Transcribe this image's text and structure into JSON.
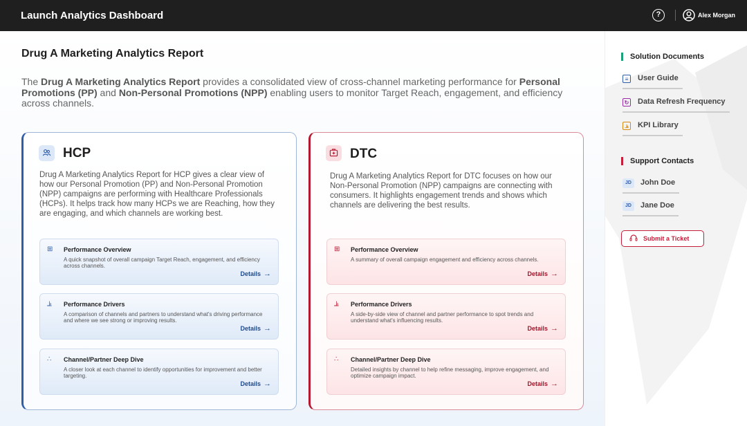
{
  "topbar": {
    "title": "Launch Analytics Dashboard",
    "help_glyph": "?",
    "user_name": "Alex Morgan"
  },
  "page": {
    "title": "Drug A Marketing Analytics Report",
    "intro": [
      {
        "text": "The ",
        "bold": false
      },
      {
        "text": "Drug A Marketing Analytics Report",
        "bold": true
      },
      {
        "text": " provides a consolidated view of cross-channel marketing performance for ",
        "bold": false
      },
      {
        "text": "Personal Promotions (PP)",
        "bold": true
      },
      {
        "text": " and ",
        "bold": false
      },
      {
        "text": "Non-Personal Promotions (NPP)",
        "bold": true
      },
      {
        "text": " enabling users to monitor Target Reach, engagement, and efficiency across channels.",
        "bold": false
      }
    ]
  },
  "hcp": {
    "title": "HCP",
    "icon": "people-icon",
    "desc": "Drug A Marketing Analytics Report for HCP gives a clear view of how our Personal Promotion (PP) and  Non-Personal Promotion (NPP) campaigns are performing with Healthcare Professionals (HCPs). It helps track how many HCPs we are Reaching, how they are engaging, and which channels are working best.",
    "items": [
      {
        "title": "Performance Overview",
        "desc": "A quick snapshot of overall campaign Target Reach, engagement, and efficiency across channels.",
        "details": "Details"
      },
      {
        "title": "Performance Drivers",
        "desc": "A comparison of channels and partners to understand what's driving performance and where we see strong or improving results.",
        "details": "Details"
      },
      {
        "title": "Channel/Partner Deep Dive",
        "desc": "A closer look at each channel to identify opportunities for improvement and better targeting.",
        "details": "Details"
      }
    ]
  },
  "dtc": {
    "title": "DTC",
    "icon": "medical-kit-icon",
    "desc": "Drug A Marketing Analytics Report for DTC focuses on how our Non-Personal Promotion (NPP) campaigns are connecting with consumers. It highlights engagement trends and shows which channels are delivering the best results.",
    "items": [
      {
        "title": "Performance Overview",
        "desc": "A summary of overall campaign engagement and efficiency across channels.",
        "details": "Details"
      },
      {
        "title": "Performance Drivers",
        "desc": "A side-by-side view of channel and partner performance to spot trends and understand what's influencing results.",
        "details": "Details"
      },
      {
        "title": "Channel/Partner Deep Dive",
        "desc": "Detailed insights by channel to help refine messaging, improve engagement, and optimize campaign impact.",
        "details": "Details"
      }
    ]
  },
  "sidebar": {
    "docs_heading": "Solution Documents",
    "docs": [
      {
        "label": "User Guide",
        "icon": "document-icon"
      },
      {
        "label": "Data Refresh Frequency",
        "icon": "refresh-icon"
      },
      {
        "label": "KPI Library",
        "icon": "chart-icon"
      }
    ],
    "support_heading": "Support Contacts",
    "contacts": [
      {
        "initials": "JD",
        "name": "John Doe"
      },
      {
        "initials": "JD",
        "name": "Jane Doe"
      }
    ],
    "ticket_label": "Submit a Ticket"
  },
  "colors": {
    "hcp_accent": "#2f5ea8",
    "dtc_accent": "#b4172f",
    "docs_accent": "#1aa07a",
    "support_accent": "#c41e3a",
    "topbar": "#1f1f1f"
  }
}
